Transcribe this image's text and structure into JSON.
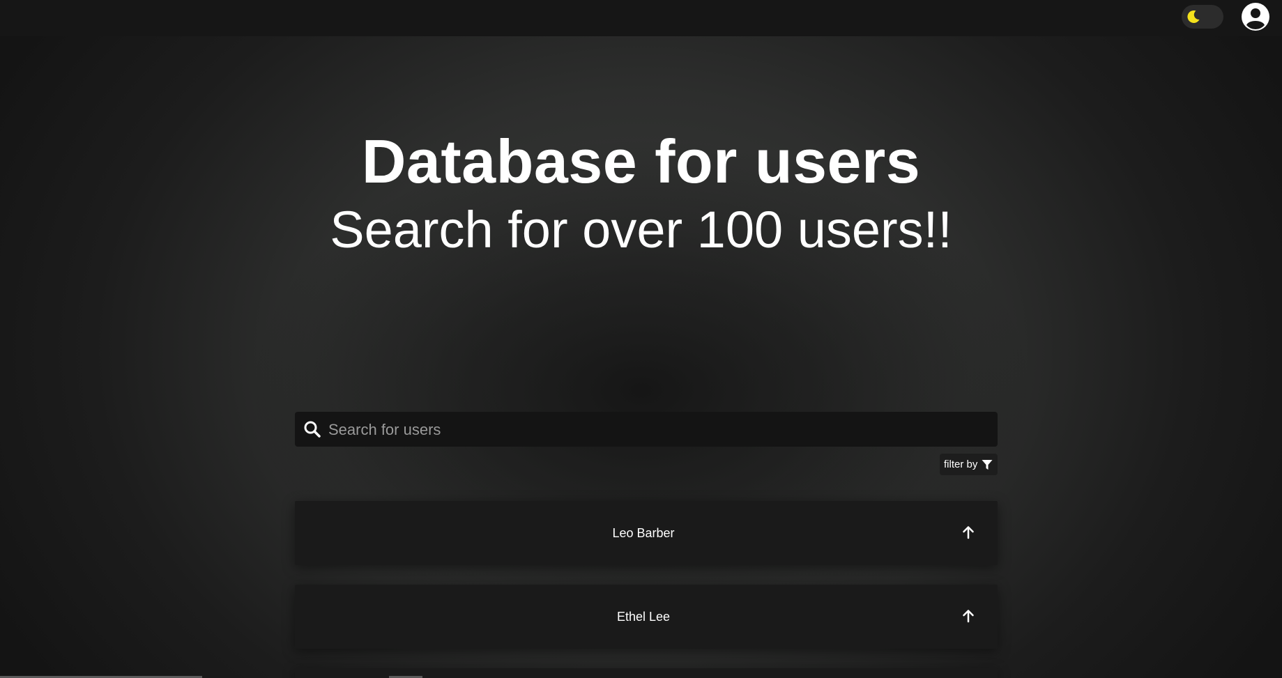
{
  "header": {
    "theme_toggle_icon": "moon-icon",
    "profile_icon": "user-avatar-icon",
    "moon_color": "#f4e21c"
  },
  "hero": {
    "title": "Database for users",
    "subtitle": "Search for over 100 users!!"
  },
  "search": {
    "icon": "search-icon",
    "placeholder": "Search for users",
    "value": ""
  },
  "filter": {
    "label": "filter by",
    "icon": "filter-icon"
  },
  "users": [
    {
      "name": "Leo Barber",
      "icon": "arrow-up-icon"
    },
    {
      "name": "Ethel Lee",
      "icon": "arrow-up-icon"
    }
  ]
}
